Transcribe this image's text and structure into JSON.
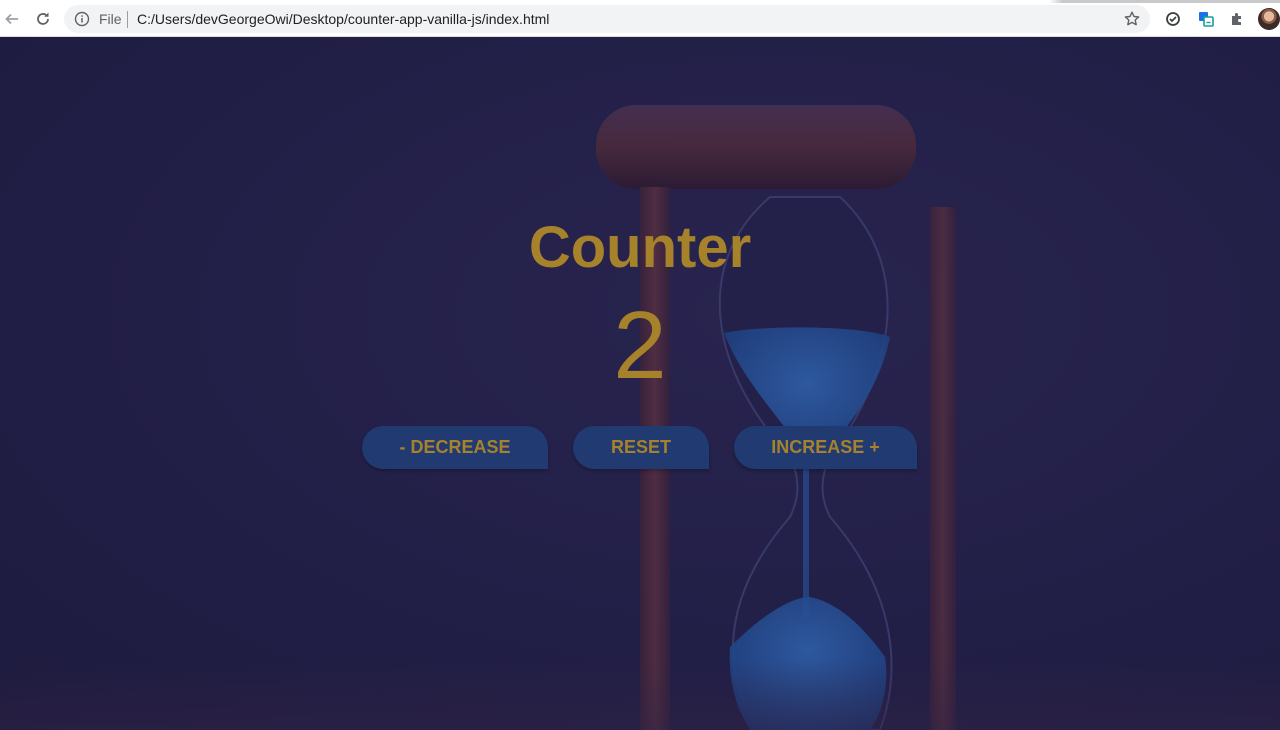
{
  "browser": {
    "url_scheme_label": "File",
    "url": "C:/Users/devGeorgeOwi/Desktop/counter-app-vanilla-js/index.html",
    "icons": [
      "back-arrow-icon",
      "reload-icon",
      "info-icon",
      "star-icon",
      "sync-icon",
      "translate-icon",
      "extensions-icon",
      "profile-avatar"
    ]
  },
  "app": {
    "title": "Counter",
    "count": "2",
    "buttons": {
      "decrease": "- DECREASE",
      "reset": "RESET",
      "increase": "INCREASE +"
    },
    "colors": {
      "text": "#a6822a",
      "button_bg": "#213a72",
      "background": "#211f45"
    }
  }
}
